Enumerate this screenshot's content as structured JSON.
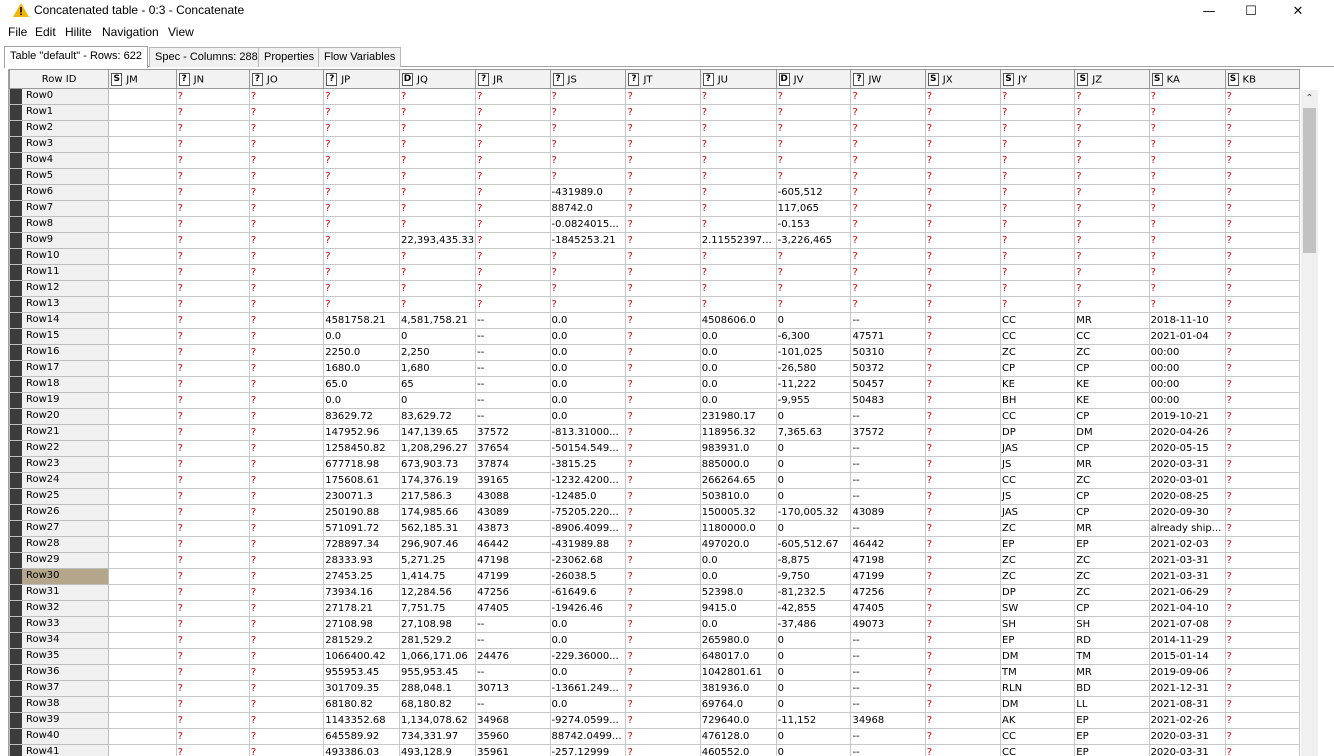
{
  "window": {
    "title": "Concatenated table - 0:3 - Concatenate",
    "minimize": "—",
    "maximize": "☐",
    "close": "✕",
    "warning_icon_color": "#f2b705"
  },
  "menu": [
    "File",
    "Edit",
    "Hilite",
    "Navigation",
    "View"
  ],
  "tabs": [
    "Table \"default\" - Rows: 622",
    "Spec - Columns: 288",
    "Properties",
    "Flow Variables"
  ],
  "columns": [
    {
      "type": "",
      "name": "Row ID"
    },
    {
      "type": "S",
      "name": "JM"
    },
    {
      "type": "?",
      "name": "JN"
    },
    {
      "type": "?",
      "name": "JO"
    },
    {
      "type": "?",
      "name": "JP"
    },
    {
      "type": "D",
      "name": "JQ"
    },
    {
      "type": "?",
      "name": "JR"
    },
    {
      "type": "?",
      "name": "JS"
    },
    {
      "type": "?",
      "name": "JT"
    },
    {
      "type": "?",
      "name": "JU"
    },
    {
      "type": "D",
      "name": "JV"
    },
    {
      "type": "?",
      "name": "JW"
    },
    {
      "type": "S",
      "name": "JX"
    },
    {
      "type": "S",
      "name": "JY"
    },
    {
      "type": "S",
      "name": "JZ"
    },
    {
      "type": "S",
      "name": "KA"
    },
    {
      "type": "S",
      "name": "KB"
    }
  ],
  "selected_row": "Row30",
  "rows": [
    [
      "Row0",
      "",
      "?",
      "?",
      "?",
      "?",
      "?",
      "?",
      "?",
      "?",
      "?",
      "?",
      "?",
      "?",
      "?",
      "?",
      "?"
    ],
    [
      "Row1",
      "",
      "?",
      "?",
      "?",
      "?",
      "?",
      "?",
      "?",
      "?",
      "?",
      "?",
      "?",
      "?",
      "?",
      "?",
      "?"
    ],
    [
      "Row2",
      "",
      "?",
      "?",
      "?",
      "?",
      "?",
      "?",
      "?",
      "?",
      "?",
      "?",
      "?",
      "?",
      "?",
      "?",
      "?"
    ],
    [
      "Row3",
      "",
      "?",
      "?",
      "?",
      "?",
      "?",
      "?",
      "?",
      "?",
      "?",
      "?",
      "?",
      "?",
      "?",
      "?",
      "?"
    ],
    [
      "Row4",
      "",
      "?",
      "?",
      "?",
      "?",
      "?",
      "?",
      "?",
      "?",
      "?",
      "?",
      "?",
      "?",
      "?",
      "?",
      "?"
    ],
    [
      "Row5",
      "",
      "?",
      "?",
      "?",
      "?",
      "?",
      "?",
      "?",
      "?",
      "?",
      "?",
      "?",
      "?",
      "?",
      "?",
      "?"
    ],
    [
      "Row6",
      "",
      "?",
      "?",
      "?",
      "?",
      "?",
      "-431989.0",
      "?",
      "?",
      "-605,512",
      "?",
      "?",
      "?",
      "?",
      "?",
      "?"
    ],
    [
      "Row7",
      "",
      "?",
      "?",
      "?",
      "?",
      "?",
      "88742.0",
      "?",
      "?",
      "117,065",
      "?",
      "?",
      "?",
      "?",
      "?",
      "?"
    ],
    [
      "Row8",
      "",
      "?",
      "?",
      "?",
      "?",
      "?",
      "-0.0824015...",
      "?",
      "?",
      "-0.153",
      "?",
      "?",
      "?",
      "?",
      "?",
      "?"
    ],
    [
      "Row9",
      "",
      "?",
      "?",
      "?",
      "22,393,435.33",
      "?",
      "-1845253.21",
      "?",
      "2.11552397...",
      "-3,226,465",
      "?",
      "?",
      "?",
      "?",
      "?",
      "?"
    ],
    [
      "Row10",
      "",
      "?",
      "?",
      "?",
      "?",
      "?",
      "?",
      "?",
      "?",
      "?",
      "?",
      "?",
      "?",
      "?",
      "?",
      "?"
    ],
    [
      "Row11",
      "",
      "?",
      "?",
      "?",
      "?",
      "?",
      "?",
      "?",
      "?",
      "?",
      "?",
      "?",
      "?",
      "?",
      "?",
      "?"
    ],
    [
      "Row12",
      "",
      "?",
      "?",
      "?",
      "?",
      "?",
      "?",
      "?",
      "?",
      "?",
      "?",
      "?",
      "?",
      "?",
      "?",
      "?"
    ],
    [
      "Row13",
      "",
      "?",
      "?",
      "?",
      "?",
      "?",
      "?",
      "?",
      "?",
      "?",
      "?",
      "?",
      "?",
      "?",
      "?",
      "?"
    ],
    [
      "Row14",
      "",
      "?",
      "?",
      "4581758.21",
      "4,581,758.21",
      "--",
      "0.0",
      "?",
      "4508606.0",
      "0",
      "--",
      "?",
      "CC",
      "MR",
      "2018-11-10",
      "?"
    ],
    [
      "Row15",
      "",
      "?",
      "?",
      "0.0",
      "0",
      "--",
      "0.0",
      "?",
      "0.0",
      "-6,300",
      "47571",
      "?",
      "CC",
      "CC",
      "2021-01-04",
      "?"
    ],
    [
      "Row16",
      "",
      "?",
      "?",
      "2250.0",
      "2,250",
      "--",
      "0.0",
      "?",
      "0.0",
      "-101,025",
      "50310",
      "?",
      "ZC",
      "ZC",
      "00:00",
      "?"
    ],
    [
      "Row17",
      "",
      "?",
      "?",
      "1680.0",
      "1,680",
      "--",
      "0.0",
      "?",
      "0.0",
      "-26,580",
      "50372",
      "?",
      "CP",
      "CP",
      "00:00",
      "?"
    ],
    [
      "Row18",
      "",
      "?",
      "?",
      "65.0",
      "65",
      "--",
      "0.0",
      "?",
      "0.0",
      "-11,222",
      "50457",
      "?",
      "KE",
      "KE",
      "00:00",
      "?"
    ],
    [
      "Row19",
      "",
      "?",
      "?",
      "0.0",
      "0",
      "--",
      "0.0",
      "?",
      "0.0",
      "-9,955",
      "50483",
      "?",
      "BH",
      "KE",
      "00:00",
      "?"
    ],
    [
      "Row20",
      "",
      "?",
      "?",
      "83629.72",
      "83,629.72",
      "--",
      "0.0",
      "?",
      "231980.17",
      "0",
      "--",
      "?",
      "CC",
      "CP",
      "2019-10-21",
      "?"
    ],
    [
      "Row21",
      "",
      "?",
      "?",
      "147952.96",
      "147,139.65",
      "37572",
      "-813.31000...",
      "?",
      "118956.32",
      "7,365.63",
      "37572",
      "?",
      "DP",
      "DM",
      "2020-04-26",
      "?"
    ],
    [
      "Row22",
      "",
      "?",
      "?",
      "1258450.82",
      "1,208,296.27",
      "37654",
      "-50154.549...",
      "?",
      "983931.0",
      "0",
      "--",
      "?",
      "JAS",
      "CP",
      "2020-05-15",
      "?"
    ],
    [
      "Row23",
      "",
      "?",
      "?",
      "677718.98",
      "673,903.73",
      "37874",
      "-3815.25",
      "?",
      "885000.0",
      "0",
      "--",
      "?",
      "JS",
      "MR",
      "2020-03-31",
      "?"
    ],
    [
      "Row24",
      "",
      "?",
      "?",
      "175608.61",
      "174,376.19",
      "39165",
      "-1232.4200...",
      "?",
      "266264.65",
      "0",
      "--",
      "?",
      "CC",
      "ZC",
      "2020-03-01",
      "?"
    ],
    [
      "Row25",
      "",
      "?",
      "?",
      "230071.3",
      "217,586.3",
      "43088",
      "-12485.0",
      "?",
      "503810.0",
      "0",
      "--",
      "?",
      "JS",
      "CP",
      "2020-08-25",
      "?"
    ],
    [
      "Row26",
      "",
      "?",
      "?",
      "250190.88",
      "174,985.66",
      "43089",
      "-75205.220...",
      "?",
      "150005.32",
      "-170,005.32",
      "43089",
      "?",
      "JAS",
      "CP",
      "2020-09-30",
      "?"
    ],
    [
      "Row27",
      "",
      "?",
      "?",
      "571091.72",
      "562,185.31",
      "43873",
      "-8906.4099...",
      "?",
      "1180000.0",
      "0",
      "--",
      "?",
      "ZC",
      "MR",
      "already ship...",
      "?"
    ],
    [
      "Row28",
      "",
      "?",
      "?",
      "728897.34",
      "296,907.46",
      "46442",
      "-431989.88",
      "?",
      "497020.0",
      "-605,512.67",
      "46442",
      "?",
      "EP",
      "EP",
      "2021-02-03",
      "?"
    ],
    [
      "Row29",
      "",
      "?",
      "?",
      "28333.93",
      "5,271.25",
      "47198",
      "-23062.68",
      "?",
      "0.0",
      "-8,875",
      "47198",
      "?",
      "ZC",
      "ZC",
      "2021-03-31",
      "?"
    ],
    [
      "Row30",
      "",
      "?",
      "?",
      "27453.25",
      "1,414.75",
      "47199",
      "-26038.5",
      "?",
      "0.0",
      "-9,750",
      "47199",
      "?",
      "ZC",
      "ZC",
      "2021-03-31",
      "?"
    ],
    [
      "Row31",
      "",
      "?",
      "?",
      "73934.16",
      "12,284.56",
      "47256",
      "-61649.6",
      "?",
      "52398.0",
      "-81,232.5",
      "47256",
      "?",
      "DP",
      "ZC",
      "2021-06-29",
      "?"
    ],
    [
      "Row32",
      "",
      "?",
      "?",
      "27178.21",
      "7,751.75",
      "47405",
      "-19426.46",
      "?",
      "9415.0",
      "-42,855",
      "47405",
      "?",
      "SW",
      "CP",
      "2021-04-10",
      "?"
    ],
    [
      "Row33",
      "",
      "?",
      "?",
      "27108.98",
      "27,108.98",
      "--",
      "0.0",
      "?",
      "0.0",
      "-37,486",
      "49073",
      "?",
      "SH",
      "SH",
      "2021-07-08",
      "?"
    ],
    [
      "Row34",
      "",
      "?",
      "?",
      "281529.2",
      "281,529.2",
      "--",
      "0.0",
      "?",
      "265980.0",
      "0",
      "--",
      "?",
      "EP",
      "RD",
      "2014-11-29",
      "?"
    ],
    [
      "Row35",
      "",
      "?",
      "?",
      "1066400.42",
      "1,066,171.06",
      "24476",
      "-229.36000...",
      "?",
      "648017.0",
      "0",
      "--",
      "?",
      "DM",
      "TM",
      "2015-01-14",
      "?"
    ],
    [
      "Row36",
      "",
      "?",
      "?",
      "955953.45",
      "955,953.45",
      "--",
      "0.0",
      "?",
      "1042801.61",
      "0",
      "--",
      "?",
      "TM",
      "MR",
      "2019-09-06",
      "?"
    ],
    [
      "Row37",
      "",
      "?",
      "?",
      "301709.35",
      "288,048.1",
      "30713",
      "-13661.249...",
      "?",
      "381936.0",
      "0",
      "--",
      "?",
      "RLN",
      "BD",
      "2021-12-31",
      "?"
    ],
    [
      "Row38",
      "",
      "?",
      "?",
      "68180.82",
      "68,180.82",
      "--",
      "0.0",
      "?",
      "69764.0",
      "0",
      "--",
      "?",
      "DM",
      "LL",
      "2021-08-31",
      "?"
    ],
    [
      "Row39",
      "",
      "?",
      "?",
      "1143352.68",
      "1,134,078.62",
      "34968",
      "-9274.0599...",
      "?",
      "729640.0",
      "-11,152",
      "34968",
      "?",
      "AK",
      "EP",
      "2021-02-26",
      "?"
    ],
    [
      "Row40",
      "",
      "?",
      "?",
      "645589.92",
      "734,331.97",
      "35960",
      "88742.0499...",
      "?",
      "476128.0",
      "0",
      "--",
      "?",
      "CC",
      "EP",
      "2020-03-31",
      "?"
    ],
    [
      "Row41",
      "",
      "?",
      "?",
      "493386.03",
      "493,128.9",
      "35961",
      "-257.12999",
      "?",
      "460552.0",
      "0",
      "--",
      "?",
      "CC",
      "EP",
      "2020-03-31",
      "?"
    ]
  ]
}
